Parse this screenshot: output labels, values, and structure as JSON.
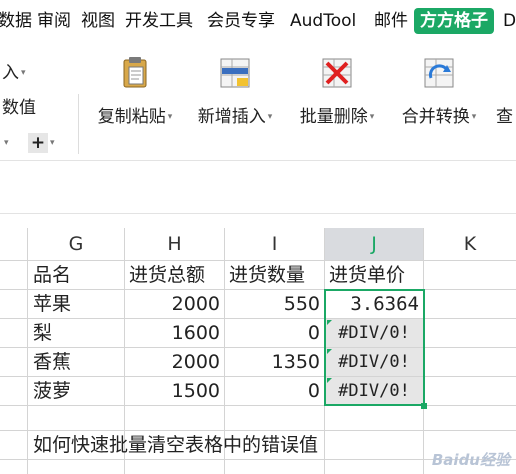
{
  "menubar": {
    "items": [
      "数据",
      "审阅",
      "视图",
      "开发工具",
      "会员专享",
      "AudTool",
      "邮件",
      "方方格子",
      "D"
    ],
    "active_index": 7
  },
  "ribbon": {
    "left": {
      "import_label": "入",
      "numeric_label": "数值",
      "plus_label": "+"
    },
    "tools": [
      {
        "label": "复制粘贴",
        "icon": "clipboard-icon"
      },
      {
        "label": "新增插入",
        "icon": "insert-icon"
      },
      {
        "label": "批量删除",
        "icon": "delete-icon"
      },
      {
        "label": "合并转换",
        "icon": "convert-icon"
      },
      {
        "label": "查",
        "icon": "search-icon"
      }
    ]
  },
  "sheet": {
    "columns": [
      "G",
      "H",
      "I",
      "J",
      "K"
    ],
    "selected_column": "J",
    "rows": [
      {
        "G": "品名",
        "H": "进货总额",
        "I": "进货数量",
        "J": "进货单价"
      },
      {
        "G": "苹果",
        "H": "2000",
        "I": "550",
        "J": "3.6364"
      },
      {
        "G": "梨",
        "H": "1600",
        "I": "0",
        "J": "#DIV/0!"
      },
      {
        "G": "香蕉",
        "H": "2000",
        "I": "1350",
        "J": "#DIV/0!"
      },
      {
        "G": "菠萝",
        "H": "1500",
        "I": "0",
        "J": "#DIV/0!"
      }
    ],
    "note": "如何快速批量清空表格中的错误值"
  },
  "watermark": "Baidu经验",
  "colors": {
    "accent": "#1ba865",
    "selected_header_bg": "#d9dbdf",
    "error_cell_bg": "#e6e6e6"
  }
}
